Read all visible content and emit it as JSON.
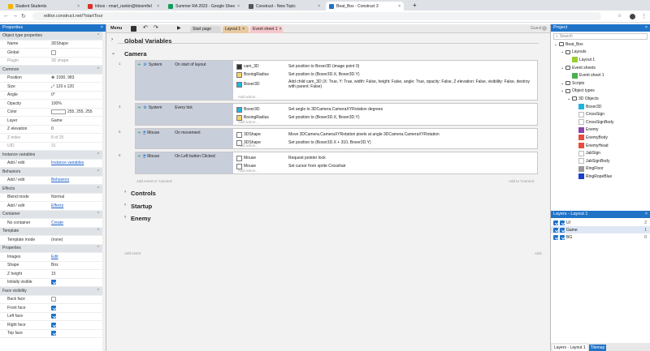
{
  "browser": {
    "tabs": [
      {
        "label": "Student Students",
        "color": "#f4b400"
      },
      {
        "label": "Inbox - rmart_rankin@bloomfiel",
        "color": "#d93025"
      },
      {
        "label": "Summer RA 2023 - Google Shee",
        "color": "#0f9d58"
      },
      {
        "label": "Construct - New Topic",
        "color": "#555555"
      },
      {
        "label": "Beat_Box - Construct 3",
        "color": "#1f73c7"
      }
    ],
    "new_tab": "+",
    "url": "editor.construct.net/?startTour"
  },
  "properties": {
    "title": "Properties",
    "rows": [
      {
        "k": "Object type properties",
        "sec": true
      },
      {
        "k": "Name",
        "v": "3DShape"
      },
      {
        "k": "Global",
        "cb": false
      },
      {
        "k": "Plugin",
        "v": "3D shape",
        "dim": true
      },
      {
        "k": "Common",
        "sec": true
      },
      {
        "k": "Position",
        "v": "1930, 983",
        "icon": "position"
      },
      {
        "k": "Size",
        "v": "120 x 120",
        "icon": "size"
      },
      {
        "k": "Angle",
        "v": "0°"
      },
      {
        "k": "Opacity",
        "v": "100%"
      },
      {
        "k": "Color",
        "v": "255, 255, 255",
        "swatch": true
      },
      {
        "k": "Layer",
        "v": "Game"
      },
      {
        "k": "Z elevation",
        "v": "0"
      },
      {
        "k": "Z index",
        "v": "8 of 25",
        "dim": true
      },
      {
        "k": "UID",
        "v": "31",
        "dim": true
      },
      {
        "k": "Instance variables",
        "sec": true
      },
      {
        "k": "Add / edit",
        "link": "Instance variables"
      },
      {
        "k": "Behaviors",
        "sec": true
      },
      {
        "k": "Add / edit",
        "link": "Behaviors"
      },
      {
        "k": "Effects",
        "sec": true
      },
      {
        "k": "Blend mode",
        "v": "Normal"
      },
      {
        "k": "Add / edit",
        "link": "Effects"
      },
      {
        "k": "Container",
        "sec": true
      },
      {
        "k": "No container",
        "link": "Create"
      },
      {
        "k": "Template",
        "sec": true
      },
      {
        "k": "Template mode",
        "v": "(none)"
      },
      {
        "k": "Properties",
        "sec": true
      },
      {
        "k": "Images",
        "link": "Edit"
      },
      {
        "k": "Shape",
        "v": "Box"
      },
      {
        "k": "Z height",
        "v": "15"
      },
      {
        "k": "Initially visible",
        "cb": true
      },
      {
        "k": "Face visibility",
        "sec": true
      },
      {
        "k": "Back face",
        "cb": false
      },
      {
        "k": "Front face",
        "cb": true
      },
      {
        "k": "Left face",
        "cb": true
      },
      {
        "k": "Right face",
        "cb": true
      },
      {
        "k": "Top face",
        "cb": true
      }
    ]
  },
  "toolbar": {
    "menu": "Menu",
    "play": "▶",
    "undo": "↶",
    "redo": "↷",
    "guest": "Guest"
  },
  "doc_tabs": [
    {
      "label": "Start page",
      "bg": "#d9d9d9"
    },
    {
      "label": "Layout 1",
      "bg": "#e8c9a0",
      "close": "×"
    },
    {
      "label": "Event sheet 1",
      "bg": "#f5c6cb",
      "close": "×"
    }
  ],
  "sheet": {
    "global_vars": "Global Variables",
    "camera": "Camera",
    "controls": "Controls",
    "startup": "Startup",
    "enemy": "Enemy",
    "add_action": "Add action...",
    "add_event": "Add event",
    "add_event_to": "Add event to 'Camera'",
    "add_to_camera": "Add to 'Camera'",
    "add_event_root": "Add event",
    "add_dots": "Add...",
    "line_nums": [
      "1",
      "2",
      "3",
      "4",
      "5",
      "6"
    ],
    "events": [
      {
        "obj": "System",
        "cond": "On start of layout",
        "actions": [
          {
            "obj": "cam_3D",
            "text": "Set position to Boxer3D (image point 0)",
            "icon": "#333333"
          },
          {
            "obj": "BoxingRadius",
            "text": "Set position to (Boxer3D.X, Boxer3D.Y)",
            "icon": "#f7d26a"
          },
          {
            "obj": "Boxer3D",
            "text": "Add child cam_3D (X: True, Y: True, width: False, height: False, angle: True, opacity: False, Z elevation: False, visibility: False, destroy with parent: False)",
            "icon": "#1eb4e0"
          }
        ]
      },
      {
        "obj": "System",
        "cond": "Every tick",
        "actions": [
          {
            "obj": "Boxer3D",
            "text": "Set angle to 3DCamera.CameraXYRotation degrees",
            "icon": "#1eb4e0"
          },
          {
            "obj": "BoxingRadius",
            "text": "Set position to (Boxer3D.X, Boxer3D.Y)",
            "icon": "#f7d26a"
          }
        ]
      },
      {
        "obj": "Mouse",
        "cond": "On movement",
        "actions": [
          {
            "obj": "3DShape",
            "text": "Move 3DCamera.CameraXYRotation pixels at angle 3DCamera.CameraXYRotation",
            "icon": "#ffffff"
          },
          {
            "obj": "3DShape",
            "text": "Set position to (Boxer3D.X + 310, Boxer3D.Y)",
            "icon": "#ffffff"
          }
        ]
      },
      {
        "obj": "Mouse",
        "cond": "On Left button Clicked",
        "actions": [
          {
            "obj": "Mouse",
            "text": "Request pointer lock",
            "icon": "#ffffff"
          },
          {
            "obj": "Mouse",
            "text": "Set cursor from sprite  Crosshair",
            "icon": "#ffffff"
          }
        ]
      }
    ]
  },
  "project": {
    "title": "Project",
    "search": "Search",
    "tree": [
      {
        "l": "Beat_Box",
        "d": 0,
        "t": "fold"
      },
      {
        "l": "Layouts",
        "d": 1,
        "t": "fold"
      },
      {
        "l": "Layout 1",
        "d": 2,
        "t": "item",
        "c": "#9acd32"
      },
      {
        "l": "Event sheets",
        "d": 1,
        "t": "fold"
      },
      {
        "l": "Event sheet 1",
        "d": 2,
        "t": "item",
        "c": "#4caf50"
      },
      {
        "l": "Scripts",
        "d": 1,
        "t": "fold"
      },
      {
        "l": "Object types",
        "d": 1,
        "t": "fold"
      },
      {
        "l": "3D Objects",
        "d": 2,
        "t": "fold"
      },
      {
        "l": "Boxer3D",
        "d": 3,
        "t": "item",
        "c": "#1eb4e0"
      },
      {
        "l": "CrossSign",
        "d": 3,
        "t": "item",
        "c": "#ffffff"
      },
      {
        "l": "CrossSignBody",
        "d": 3,
        "t": "item",
        "c": "#ffffff"
      },
      {
        "l": "Enemy",
        "d": 3,
        "t": "item",
        "c": "#8e44ad"
      },
      {
        "l": "EnemyBody",
        "d": 3,
        "t": "item",
        "c": "#e74c3c"
      },
      {
        "l": "EnemyHead",
        "d": 3,
        "t": "item",
        "c": "#e74c3c"
      },
      {
        "l": "JabSign",
        "d": 3,
        "t": "item",
        "c": "#ffffff"
      },
      {
        "l": "JabSignBody",
        "d": 3,
        "t": "item",
        "c": "#ffffff"
      },
      {
        "l": "RingFloor",
        "d": 3,
        "t": "item",
        "c": "#999999"
      },
      {
        "l": "RingRopeBlue",
        "d": 3,
        "t": "item",
        "c": "#1a3fcf"
      }
    ]
  },
  "layers": {
    "title": "Layers - Layout 1",
    "rows": [
      {
        "l": "UI",
        "n": "2"
      },
      {
        "l": "Game",
        "n": "1"
      },
      {
        "l": "BG",
        "n": "0"
      }
    ],
    "tab1": "Layers - Layout 1",
    "tab2": "Tilemap"
  }
}
